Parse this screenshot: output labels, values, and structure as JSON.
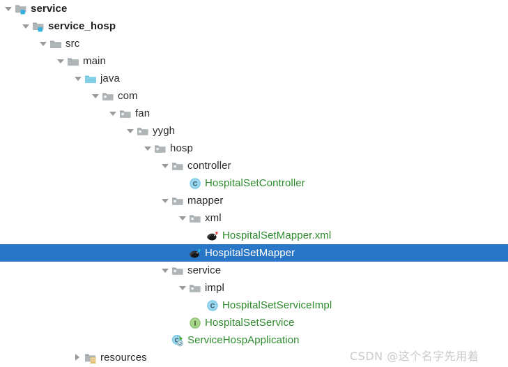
{
  "tree": {
    "rows": [
      {
        "label": "service",
        "depth": 0,
        "twisty": "expanded",
        "icon": "module-folder-icon",
        "style": "bold",
        "selected": false
      },
      {
        "label": "service_hosp",
        "depth": 1,
        "twisty": "expanded",
        "icon": "module-folder-icon",
        "style": "bold",
        "selected": false
      },
      {
        "label": "src",
        "depth": 2,
        "twisty": "expanded",
        "icon": "folder-icon",
        "style": "normal",
        "selected": false
      },
      {
        "label": "main",
        "depth": 3,
        "twisty": "expanded",
        "icon": "folder-icon",
        "style": "normal",
        "selected": false
      },
      {
        "label": "java",
        "depth": 4,
        "twisty": "expanded",
        "icon": "source-folder-icon",
        "style": "normal",
        "selected": false
      },
      {
        "label": "com",
        "depth": 5,
        "twisty": "expanded",
        "icon": "package-icon",
        "style": "normal",
        "selected": false
      },
      {
        "label": "fan",
        "depth": 6,
        "twisty": "expanded",
        "icon": "package-icon",
        "style": "normal",
        "selected": false
      },
      {
        "label": "yygh",
        "depth": 7,
        "twisty": "expanded",
        "icon": "package-icon",
        "style": "normal",
        "selected": false
      },
      {
        "label": "hosp",
        "depth": 8,
        "twisty": "expanded",
        "icon": "package-icon",
        "style": "normal",
        "selected": false
      },
      {
        "label": "controller",
        "depth": 9,
        "twisty": "expanded",
        "icon": "package-icon",
        "style": "normal",
        "selected": false
      },
      {
        "label": "HospitalSetController",
        "depth": 10,
        "twisty": "none",
        "icon": "java-class-icon",
        "style": "java",
        "selected": false
      },
      {
        "label": "mapper",
        "depth": 9,
        "twisty": "expanded",
        "icon": "package-icon",
        "style": "normal",
        "selected": false
      },
      {
        "label": "xml",
        "depth": 10,
        "twisty": "expanded",
        "icon": "package-icon",
        "style": "normal",
        "selected": false
      },
      {
        "label": "HospitalSetMapper.xml",
        "depth": 11,
        "twisty": "none",
        "icon": "mybatis-xml-icon",
        "style": "java",
        "selected": false
      },
      {
        "label": "HospitalSetMapper",
        "depth": 10,
        "twisty": "none",
        "icon": "mybatis-mapper-icon",
        "style": "selected",
        "selected": true
      },
      {
        "label": "service",
        "depth": 9,
        "twisty": "expanded",
        "icon": "package-icon",
        "style": "normal",
        "selected": false
      },
      {
        "label": "impl",
        "depth": 10,
        "twisty": "expanded",
        "icon": "package-icon",
        "style": "normal",
        "selected": false
      },
      {
        "label": "HospitalSetServiceImpl",
        "depth": 11,
        "twisty": "none",
        "icon": "java-class-icon",
        "style": "java",
        "selected": false
      },
      {
        "label": "HospitalSetService",
        "depth": 10,
        "twisty": "none",
        "icon": "java-interface-icon",
        "style": "java",
        "selected": false
      },
      {
        "label": "ServiceHospApplication",
        "depth": 9,
        "twisty": "none",
        "icon": "spring-boot-app-icon",
        "style": "java",
        "selected": false
      },
      {
        "label": "resources",
        "depth": 4,
        "twisty": "collapsed",
        "icon": "resources-folder-icon",
        "style": "normal",
        "selected": false
      }
    ]
  },
  "watermark": {
    "text": "CSDN @这个名字先用着"
  },
  "colors": {
    "selection_background": "#2A76C6",
    "selection_text": "#ffffff",
    "java_file_text": "#2d8a2d",
    "plain_text": "#2b2b2b",
    "folder_gray": "#b0b5b8",
    "source_folder_blue": "#83cfe6",
    "module_badge_blue": "#2fb0e0",
    "class_icon_blue": "#8fd4ec",
    "interface_icon_green": "#96cc79",
    "watermark_gray": "#c9c9c9",
    "background": "#ffffff"
  }
}
